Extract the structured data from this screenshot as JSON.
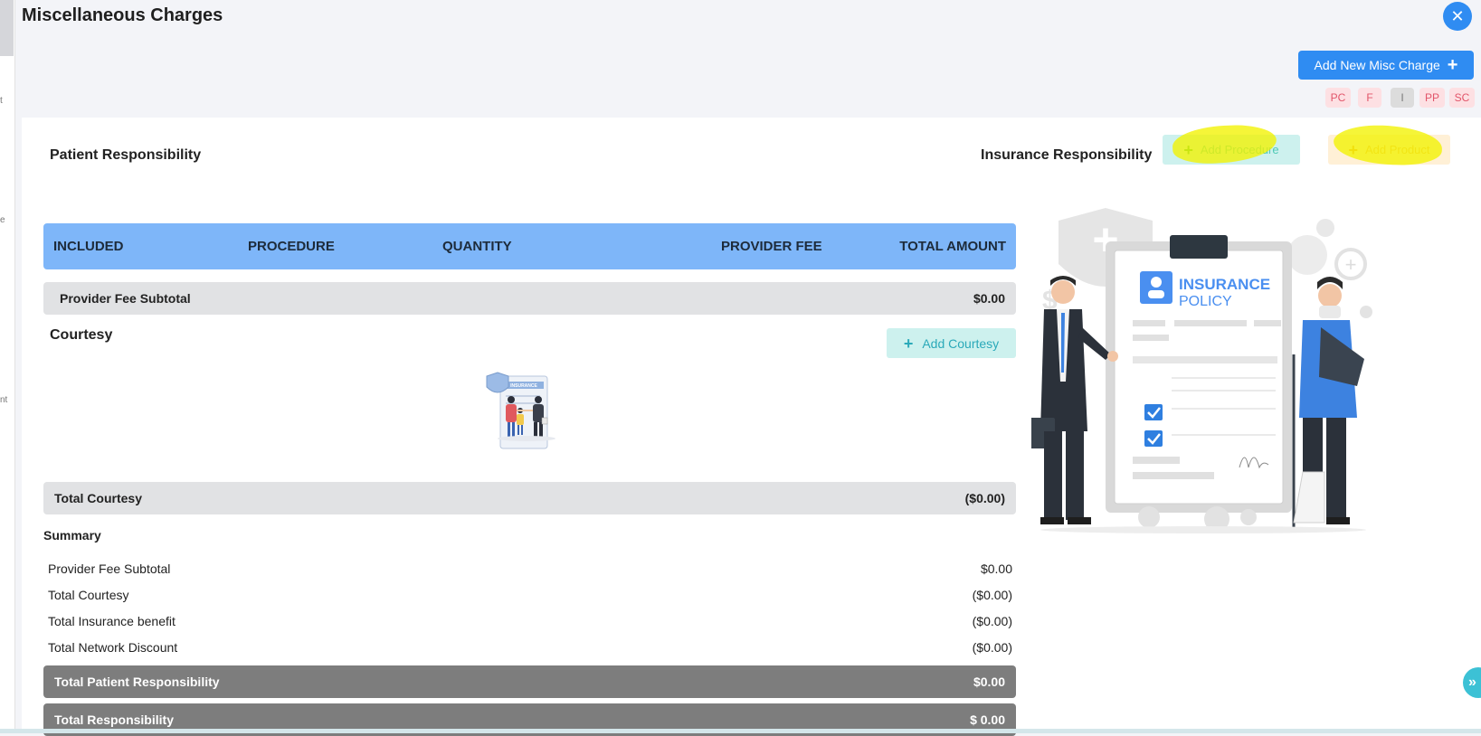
{
  "left_strip": {
    "fragments": [
      "t",
      "e",
      "nt"
    ]
  },
  "page_title": "Miscellaneous Charges",
  "close_icon": "✕",
  "add_misc_label": "Add New Misc Charge",
  "plus_glyph": "+",
  "chips": [
    "PC",
    "F",
    "I",
    "PP",
    "SC"
  ],
  "patient_responsibility_label": "Patient Responsibility",
  "insurance_responsibility_label": "Insurance Responsibility",
  "add_procedure_label": "Add Procedure",
  "add_product_label": "Add Product",
  "table": {
    "headers": [
      "INCLUDED",
      "PROCEDURE",
      "QUANTITY",
      "PROVIDER FEE",
      "TOTAL AMOUNT"
    ],
    "provider_fee_subtotal_label": "Provider Fee Subtotal",
    "provider_fee_subtotal_value": "$0.00"
  },
  "courtesy": {
    "label": "Courtesy",
    "add_label": "Add Courtesy",
    "total_label": "Total Courtesy",
    "total_value": "($0.00)"
  },
  "insurance_illustration": {
    "title_line1": "INSURANCE",
    "title_line2": "POLICY"
  },
  "small_illustration": {
    "caption": "INSURANCE"
  },
  "summary": {
    "label": "Summary",
    "rows": [
      {
        "label": "Provider Fee Subtotal",
        "value": "$0.00"
      },
      {
        "label": "Total Courtesy",
        "value": "($0.00)"
      },
      {
        "label": "Total Insurance benefit",
        "value": "($0.00)"
      },
      {
        "label": "Total Network Discount",
        "value": "($0.00)"
      }
    ],
    "total_patient_label": "Total Patient Responsibility",
    "total_patient_value": "$0.00",
    "total_resp_label": "Total Responsibility",
    "total_resp_value": "$ 0.00"
  },
  "scroll_icon": "»",
  "colors": {
    "primary": "#2f8cf2",
    "table_header": "#7eb6f9",
    "teal": "#2aa9b9",
    "highlight": "#f2f200",
    "chip_pink": "#fde0e3"
  }
}
